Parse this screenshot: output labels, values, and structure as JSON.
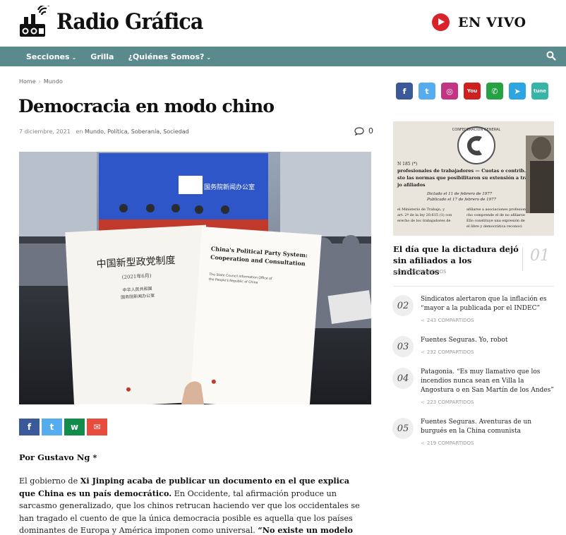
{
  "header": {
    "logo_text": "Radio Gráfica",
    "live_label": "EN VIVO"
  },
  "nav": {
    "items": [
      {
        "label": "Secciones",
        "has_dropdown": true
      },
      {
        "label": "Grilla",
        "has_dropdown": false
      },
      {
        "label": "¿Quiénes Somos?",
        "has_dropdown": true
      }
    ],
    "search_icon": "search-icon"
  },
  "breadcrumb": [
    "Home",
    "Mundo"
  ],
  "article": {
    "title": "Democracia en modo chino",
    "date": "7 diciembre, 2021",
    "categories_prefix": "en",
    "categories": "Mundo, Política, Soberanía, Sociedad",
    "comment_count": "0",
    "image": {
      "screen_text": "国务院新闻办公室",
      "book_cn_title": "中国新型政党制度",
      "book_cn_sub": "(2021年6月)",
      "book_cn_org1": "中华人民共和国",
      "book_cn_org2": "国务院新闻办公室",
      "book_en_title1": "China's Political Party System:",
      "book_en_title2": "Cooperation and Consultation",
      "book_en_org1": "The State Council Information Office of",
      "book_en_org2": "the People's Republic of China"
    },
    "byline": "Por Gustavo Ng *",
    "para1": {
      "t1": "El gobierno de ",
      "b1": "Xi Jinping acaba de publicar un documento en el que explica que China es un país democrático.",
      "t2": " En Occidente, tal afirmación produce un sarcasmo generalizado, que los chinos retrucan haciendo ver que los occidentales se han tragado el cuento de que la única democracia posible es aquella que los países dominantes de Europa y América imponen como universal. ",
      "b2": "“No existe un modelo"
    }
  },
  "share_buttons": [
    {
      "name": "facebook",
      "glyph": "f",
      "color": "#3b5998"
    },
    {
      "name": "twitter",
      "glyph": "t",
      "color": "#55acee"
    },
    {
      "name": "whatsapp",
      "glyph": "w",
      "color": "#128c4a"
    },
    {
      "name": "email",
      "glyph": "✉",
      "color": "#e74c3c"
    }
  ],
  "social": [
    {
      "name": "facebook",
      "glyph": "f",
      "color": "#3b5998"
    },
    {
      "name": "twitter",
      "glyph": "t",
      "color": "#55acee"
    },
    {
      "name": "instagram",
      "glyph": "◎",
      "color": "#c13584"
    },
    {
      "name": "youtube",
      "glyph": "You",
      "color": "#cd201f"
    },
    {
      "name": "whatsapp",
      "glyph": "✆",
      "color": "#25a244"
    },
    {
      "name": "telegram",
      "glyph": "➤",
      "color": "#2ca5e0"
    },
    {
      "name": "tunein",
      "glyph": "tune",
      "color": "#36b4a7"
    }
  ],
  "sidebar": {
    "featured": {
      "image_doc": {
        "header": "CONFEDERACION GENERAL",
        "line0": "N 185 (*)",
        "line1": "profesionales de trabajadores — Cuotas o contrib.",
        "line2": "sto las normas que posibilitaron su extensión a traj.",
        "line3": "jo afiliados",
        "line4": "Dictado el 11 de febrero de 1977",
        "line5": "Publicado el 17 de febrero de 1977",
        "line6": "el Ministerio de Trabajo, y",
        "line7": "art. 2º de la ley 20.615 (1) con",
        "line8": "erecho de los trabajadores de",
        "line9": "afiliarse a asociaciones profesion",
        "line10": "cho comprende el de no afiliarse",
        "line11": "Ello constituye una expresión de",
        "line12": "el libre y democrática reconoci"
      },
      "title": "El día que la dictadura dejó sin afiliados a los sindicatos",
      "number": "01",
      "shares": "289 COMPARTIDOS"
    },
    "ranked": [
      {
        "number": "02",
        "bold": "",
        "title": "Sindicatos alertaron que la inflación es “mayor a la publicada por el INDEC”",
        "shares": "243 COMPARTIDOS"
      },
      {
        "number": "03",
        "bold": "",
        "title": "Fuentes Seguras. Yo, robot",
        "shares": "232 COMPARTIDOS"
      },
      {
        "number": "04",
        "bold": "",
        "title": "Patagonia. “Es muy llamativo que los incendios nunca sean en Villa la Angostura o en San Martín de los Andes”",
        "shares": "223 COMPARTIDOS"
      },
      {
        "number": "05",
        "bold": "",
        "title": "Fuentes Seguras. Aventuras de un burgués en la China comunista",
        "shares": "219 COMPARTIDOS"
      }
    ]
  }
}
